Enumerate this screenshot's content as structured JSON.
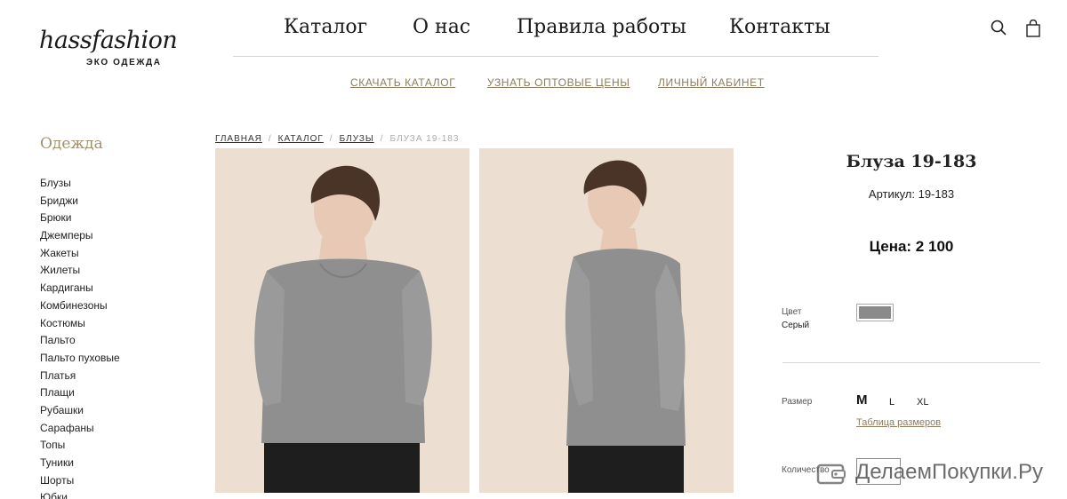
{
  "logo": {
    "script_text": "hassfashion",
    "subtitle": "ЭКО ОДЕЖДА"
  },
  "main_nav": {
    "items": [
      "Каталог",
      "О нас",
      "Правила работы",
      "Контакты"
    ]
  },
  "header_icons": {
    "search": "search-icon",
    "cart": "shopping-bag-icon"
  },
  "sub_nav": {
    "items": [
      "СКАЧАТЬ КАТАЛОГ",
      "УЗНАТЬ ОПТОВЫЕ ЦЕНЫ",
      "ЛИЧНЫЙ КАБИНЕТ"
    ]
  },
  "sidebar": {
    "title": "Одежда",
    "items": [
      "Блузы",
      "Бриджи",
      "Брюки",
      "Джемперы",
      "Жакеты",
      "Жилеты",
      "Кардиганы",
      "Комбинезоны",
      "Костюмы",
      "Пальто",
      "Пальто пуховые",
      "Платья",
      "Плащи",
      "Рубашки",
      "Сарафаны",
      "Топы",
      "Туники",
      "Шорты",
      "Юбки"
    ]
  },
  "breadcrumb": {
    "items": [
      "ГЛАВНАЯ",
      "КАТАЛОГ",
      "БЛУЗЫ"
    ],
    "separator": "/",
    "current": "БЛУЗА 19-183"
  },
  "product": {
    "title": "Блуза 19-183",
    "article": "Артикул: 19-183",
    "price": "Цена: 2 100 ",
    "currency_symbol": "",
    "color_label": "Цвет",
    "color_value": "Серый",
    "color_swatch": "#8a8a8a",
    "size_label": "Размер",
    "sizes": [
      "M",
      "L",
      "XL"
    ],
    "selected_size": "M",
    "size_table_link": "Таблица размеров",
    "quantity_label": "Количество"
  },
  "watermark": {
    "text": "ДелаемПокупки.Ру"
  },
  "colors": {
    "accent": "#8c7c5e",
    "sidebar_title": "#a0916f",
    "photo_bg": "#ecdfd2",
    "blouse": "#8f8f8f",
    "hair": "#4a3428",
    "skin": "#e7c9b5",
    "pants": "#1e1e1e"
  }
}
